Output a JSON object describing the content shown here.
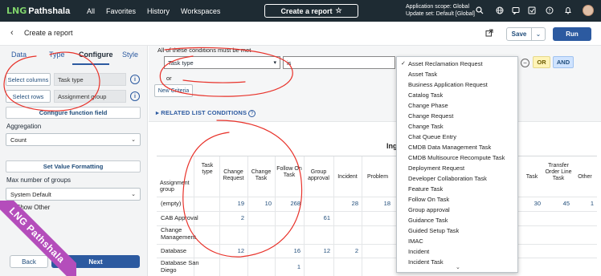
{
  "topnav": {
    "logo_mark": "LNG",
    "logo_text": "Pathshala",
    "links": [
      "All",
      "Favorites",
      "History",
      "Workspaces"
    ],
    "create_report": "Create a report",
    "scope_line1": "Application scope: Global",
    "scope_line2": "Update set: Default [Global]"
  },
  "header": {
    "title": "Create a report",
    "save_label": "Save",
    "run_label": "Run"
  },
  "left": {
    "tabs": [
      "Data",
      "Type",
      "Configure",
      "Style"
    ],
    "active_tab": "Configure",
    "select_columns_label": "Select columns",
    "columns_value": "Task type",
    "select_rows_label": "Select rows",
    "rows_value": "Assignment group",
    "configure_function_field": "Configure function field",
    "aggregation_label": "Aggregation",
    "aggregation_value": "Count",
    "set_value_formatting": "Set Value Formatting",
    "max_groups_label": "Max number of groups",
    "max_groups_value": "System Default",
    "show_other_label": "Show Other",
    "back_label": "Back",
    "next_label": "Next"
  },
  "conditions": {
    "title": "All of these conditions must be met",
    "field_value": "Task type",
    "operator_value": "is",
    "or_label": "or",
    "new_criteria_label": "New Criteria",
    "or_button": "OR",
    "and_button": "AND",
    "related_label": "RELATED LIST CONDITIONS"
  },
  "report": {
    "title_fragment": "Ing",
    "row_header": "Assignment group",
    "col_task_type": "Task type",
    "columns_left": [
      "Change Request",
      "Change Task",
      "Follow On Task",
      "Group approval",
      "Incident",
      "Problem"
    ],
    "columns_right": [
      "Task",
      "Transfer Order Line Task",
      "Other"
    ],
    "rows": [
      {
        "label": "(empty)",
        "left": [
          "19",
          "10",
          "268",
          "",
          "28",
          "18"
        ],
        "right": [
          "30",
          "45",
          "1"
        ]
      },
      {
        "label": "CAB Approval",
        "left": [
          "2",
          "",
          "",
          "61",
          "",
          ""
        ],
        "right": [
          "",
          "",
          ""
        ]
      },
      {
        "label": "Change Management",
        "left": [
          "",
          "",
          "",
          "",
          "",
          ""
        ],
        "right": [
          "",
          "",
          ""
        ]
      },
      {
        "label": "Database",
        "left": [
          "12",
          "",
          "16",
          "12",
          "2",
          ""
        ],
        "right": [
          "",
          "",
          ""
        ]
      },
      {
        "label": "Database San Diego",
        "left": [
          "",
          "",
          "1",
          "",
          "",
          ""
        ],
        "right": [
          "",
          "",
          ""
        ]
      }
    ]
  },
  "dropdown": {
    "selected": "Asset Reclamation Request",
    "items": [
      "Asset Reclamation Request",
      "Asset Task",
      "Business Application Request",
      "Catalog Task",
      "Change Phase",
      "Change Request",
      "Change Task",
      "Chat Queue Entry",
      "CMDB Data Management Task",
      "CMDB Multisource Recompute Task",
      "Deployment Request",
      "Developer Collaboration Task",
      "Feature Task",
      "Follow On Task",
      "Group approval",
      "Guidance Task",
      "Guided Setup Task",
      "IMAC",
      "Incident",
      "Incident Task"
    ]
  },
  "watermark": "LNG Pathshala",
  "colors": {
    "nav_bg": "#1e2b33",
    "primary": "#2c5aa0",
    "annotation": "#e8322a",
    "ribbon": "#b44dbb"
  }
}
